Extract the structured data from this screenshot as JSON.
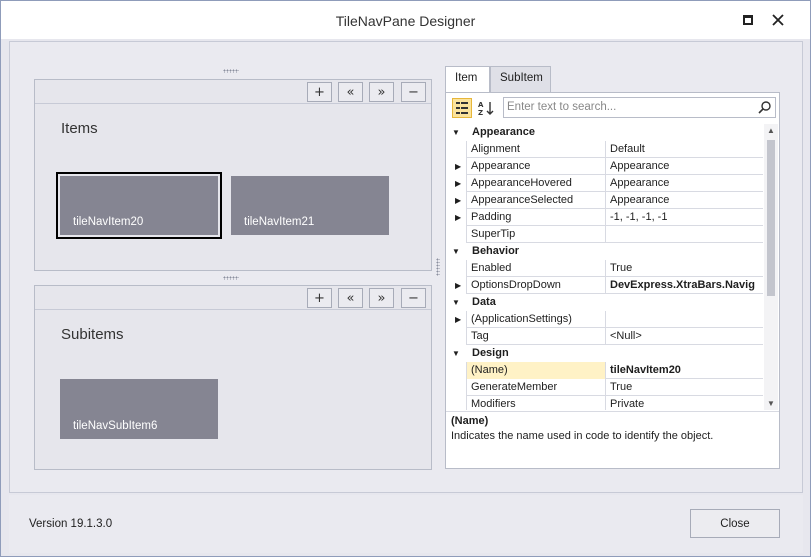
{
  "window": {
    "title": "TileNavPane Designer"
  },
  "panels": {
    "toolbar": {
      "add_label": "+",
      "move_left_label": "«",
      "move_right_label": "»",
      "remove_label": "−"
    },
    "items": {
      "title": "Items",
      "tiles": [
        "tileNavItem20",
        "tileNavItem21"
      ],
      "selected": "tileNavItem20"
    },
    "subitems": {
      "title": "Subitems",
      "tiles": [
        "tileNavSubItem6"
      ]
    }
  },
  "tabs": [
    "Item",
    "SubItem"
  ],
  "active_tab": "Item",
  "search": {
    "placeholder": "Enter text to search..."
  },
  "property_grid": {
    "rows": [
      {
        "kind": "category",
        "label": "Appearance"
      },
      {
        "kind": "prop",
        "name": "Alignment",
        "value": "Default",
        "expandable": false
      },
      {
        "kind": "prop",
        "name": "Appearance",
        "value": "Appearance",
        "expandable": true
      },
      {
        "kind": "prop",
        "name": "AppearanceHovered",
        "value": "Appearance",
        "expandable": true
      },
      {
        "kind": "prop",
        "name": "AppearanceSelected",
        "value": "Appearance",
        "expandable": true
      },
      {
        "kind": "prop",
        "name": "Padding",
        "value": "-1, -1, -1, -1",
        "expandable": true
      },
      {
        "kind": "prop",
        "name": "SuperTip",
        "value": "",
        "expandable": false
      },
      {
        "kind": "category",
        "label": "Behavior"
      },
      {
        "kind": "prop",
        "name": "Enabled",
        "value": "True",
        "expandable": false
      },
      {
        "kind": "prop",
        "name": "OptionsDropDown",
        "value": "DevExpress.XtraBars.Navig",
        "expandable": true,
        "bold_value": true
      },
      {
        "kind": "category",
        "label": "Data"
      },
      {
        "kind": "prop",
        "name": "(ApplicationSettings)",
        "value": "",
        "expandable": true
      },
      {
        "kind": "prop",
        "name": "Tag",
        "value": "<Null>",
        "expandable": false
      },
      {
        "kind": "category",
        "label": "Design"
      },
      {
        "kind": "prop",
        "name": "(Name)",
        "value": "tileNavItem20",
        "expandable": false,
        "bold_value": true,
        "selected": true
      },
      {
        "kind": "prop",
        "name": "GenerateMember",
        "value": "True",
        "expandable": false
      },
      {
        "kind": "prop",
        "name": "Modifiers",
        "value": "Private",
        "expandable": false
      }
    ]
  },
  "description": {
    "title": "(Name)",
    "text": "Indicates the name used in code to identify the object."
  },
  "footer": {
    "version": "Version 19.1.3.0",
    "close_label": "Close"
  }
}
